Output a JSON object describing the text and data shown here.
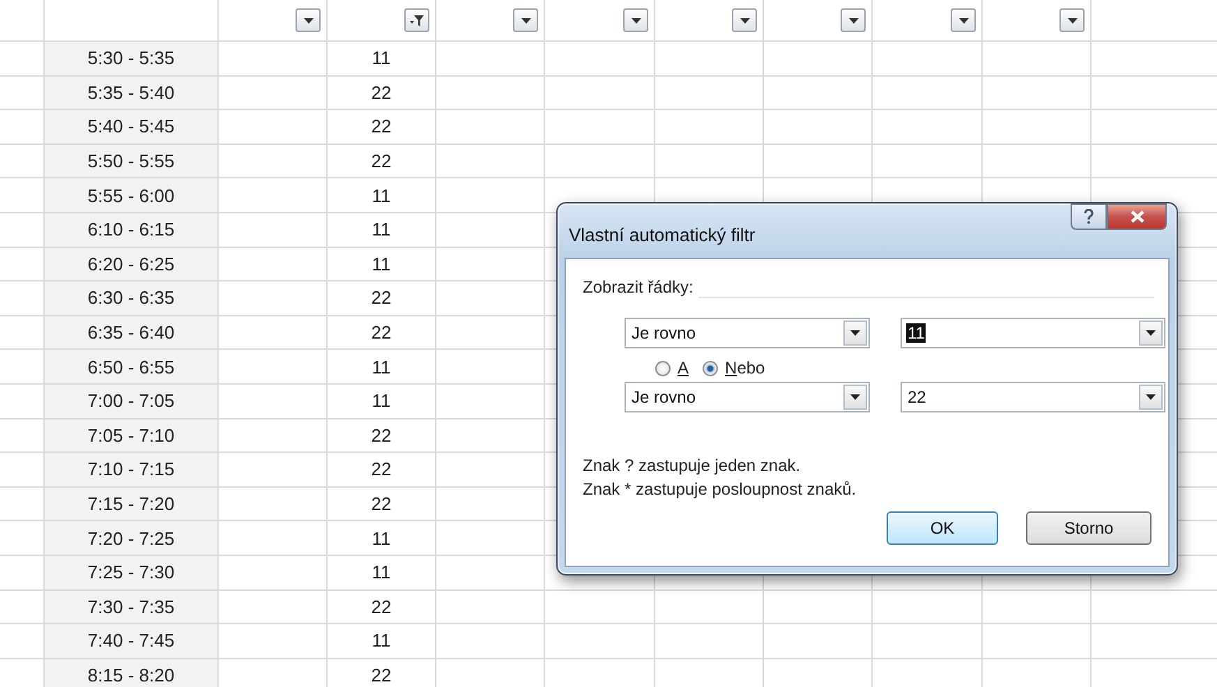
{
  "sheet": {
    "filters": [
      {
        "filtered": false
      },
      {
        "filtered": true
      },
      {
        "filtered": false
      },
      {
        "filtered": false
      },
      {
        "filtered": false
      },
      {
        "filtered": false
      },
      {
        "filtered": false
      },
      {
        "filtered": false
      }
    ],
    "rows": [
      {
        "time": "5:30 - 5:35",
        "count": "11"
      },
      {
        "time": "5:35 - 5:40",
        "count": "22"
      },
      {
        "time": "5:40 - 5:45",
        "count": "22"
      },
      {
        "time": "5:50 - 5:55",
        "count": "22"
      },
      {
        "time": "5:55 - 6:00",
        "count": "11"
      },
      {
        "time": "6:10 - 6:15",
        "count": "11"
      },
      {
        "time": "6:20 - 6:25",
        "count": "11"
      },
      {
        "time": "6:30 - 6:35",
        "count": "22"
      },
      {
        "time": "6:35 - 6:40",
        "count": "22"
      },
      {
        "time": "6:50 - 6:55",
        "count": "11"
      },
      {
        "time": "7:00 - 7:05",
        "count": "11"
      },
      {
        "time": "7:05 - 7:10",
        "count": "22"
      },
      {
        "time": "7:10 - 7:15",
        "count": "22"
      },
      {
        "time": "7:15 - 7:20",
        "count": "22"
      },
      {
        "time": "7:20 - 7:25",
        "count": "11"
      },
      {
        "time": "7:25 - 7:30",
        "count": "11"
      },
      {
        "time": "7:30 - 7:35",
        "count": "22"
      },
      {
        "time": "7:40 - 7:45",
        "count": "11"
      },
      {
        "time": "8:15 - 8:20",
        "count": "22"
      }
    ]
  },
  "dialog": {
    "title": "Vlastní automatický filtr",
    "group_label": "Zobrazit řádky:",
    "conditions": [
      {
        "operator": "Je rovno",
        "value": "11",
        "value_selected": true
      },
      {
        "operator": "Je rovno",
        "value": "22",
        "value_selected": false
      }
    ],
    "logic": [
      {
        "label": "A",
        "selected": false
      },
      {
        "label": "Nebo",
        "selected": true
      }
    ],
    "hints": [
      "Znak ? zastupuje jeden znak.",
      "Znak * zastupuje posloupnost znaků."
    ],
    "buttons": [
      {
        "label": "OK",
        "default": true
      },
      {
        "label": "Storno",
        "default": false
      }
    ]
  }
}
